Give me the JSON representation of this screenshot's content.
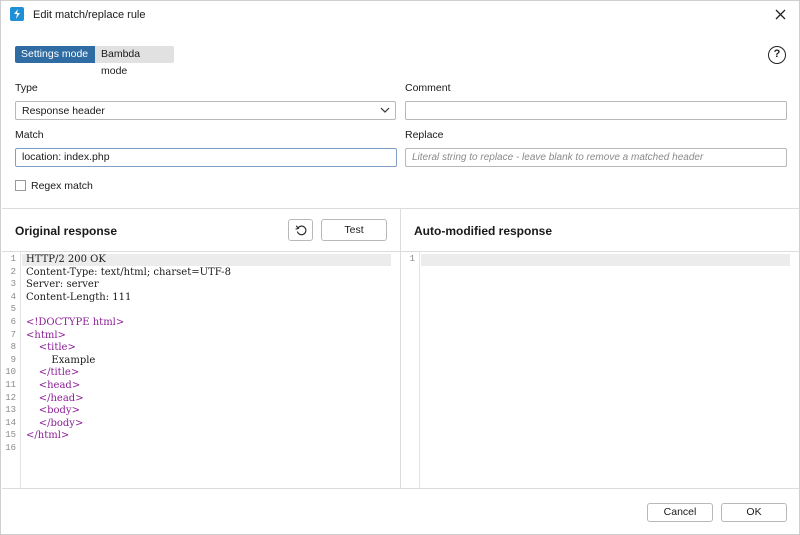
{
  "window": {
    "title": "Edit match/replace rule"
  },
  "modes": {
    "settings": "Settings mode",
    "bambda": "Bambda mode"
  },
  "labels": {
    "type": "Type",
    "comment": "Comment",
    "match": "Match",
    "replace": "Replace"
  },
  "type_select": {
    "value": "Response header"
  },
  "comment_field": {
    "value": ""
  },
  "match_field": {
    "value": "location: index.php"
  },
  "replace_field": {
    "placeholder": "Literal string to replace - leave blank to remove a matched header"
  },
  "regex": {
    "label": "Regex match",
    "checked": false
  },
  "original": {
    "title": "Original response",
    "test_label": "Test",
    "line_numbers": [
      "1",
      "2",
      "3",
      "4",
      "5",
      "6",
      "7",
      "8",
      "9",
      "10",
      "11",
      "12",
      "13",
      "14",
      "15",
      "16"
    ],
    "lines": [
      "HTTP/2 200 OK",
      "Content-Type: text/html; charset=UTF-8",
      "Server: server",
      "Content-Length: 111",
      "",
      "<!DOCTYPE html>",
      "<html>",
      "    <title>",
      "        Example",
      "    </title>",
      "    <head>",
      "    </head>",
      "    <body>",
      "    </body>",
      "</html>",
      ""
    ]
  },
  "modified": {
    "title": "Auto-modified response",
    "line_numbers": [
      "1"
    ]
  },
  "footer": {
    "cancel": "Cancel",
    "ok": "OK"
  },
  "colors": {
    "accent": "#2f6ca3",
    "app_icon": "#1f8fd6",
    "markup_tag": "#8b1f96"
  }
}
